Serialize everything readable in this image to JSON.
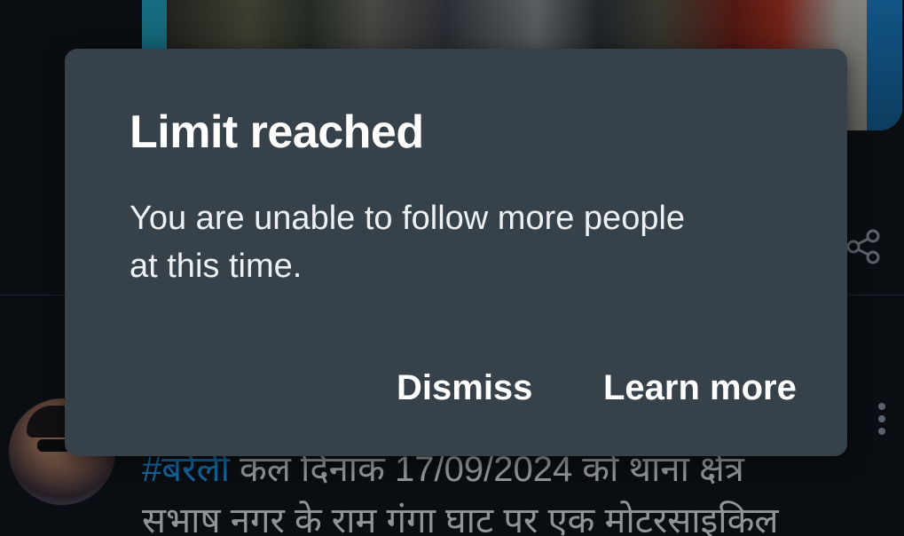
{
  "dialog": {
    "title": "Limit reached",
    "message": "You are unable to follow more people at this time.",
    "dismiss_label": "Dismiss",
    "learn_more_label": "Learn more"
  },
  "tweet": {
    "hashtag": "#बरेली",
    "text_line1_rest": " कल दिनांक 17/09/2024 को थाना क्षेत्र",
    "text_line2": "सभाष नगर के राम गंगा घाट पर एक मोटरसाइकिल"
  },
  "icons": {
    "share": "share-icon",
    "more": "more-vertical-icon"
  },
  "colors": {
    "background": "#10161c",
    "dialog": "#37414a",
    "hashtag": "#1d9bf0"
  }
}
